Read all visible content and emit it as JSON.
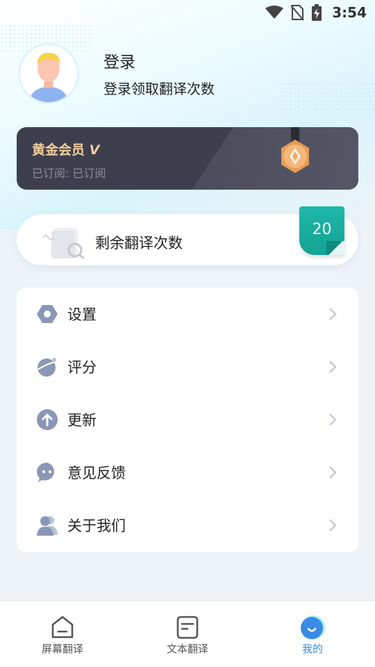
{
  "status_bar": {
    "time": "3:54",
    "icons": [
      "wifi-icon",
      "no-sim-icon",
      "battery-charging-icon"
    ]
  },
  "profile": {
    "title": "登录",
    "subtitle": "登录领取翻译次数"
  },
  "vip": {
    "title": "黄金会员",
    "badge_text": "V",
    "subscription": "已订阅: 已订阅"
  },
  "usage": {
    "label": "剩余翻译次数",
    "count": "20"
  },
  "menu": [
    {
      "label": "设置",
      "icon": "settings-icon"
    },
    {
      "label": "评分",
      "icon": "rating-planet-icon"
    },
    {
      "label": "更新",
      "icon": "update-arrow-icon"
    },
    {
      "label": "意见反馈",
      "icon": "feedback-chat-icon"
    },
    {
      "label": "关于我们",
      "icon": "about-users-icon"
    }
  ],
  "bottom_nav": [
    {
      "label": "屏幕翻译",
      "icon": "screen-translate-icon",
      "active": false
    },
    {
      "label": "文本翻译",
      "icon": "text-translate-icon",
      "active": false
    },
    {
      "label": "我的",
      "icon": "my-profile-icon",
      "active": true
    }
  ],
  "colors": {
    "accent": "#3a8be6",
    "vip_gold": "#f3cf9c",
    "teal": "#1fb8a8",
    "menu_icon": "#8a97b6"
  }
}
